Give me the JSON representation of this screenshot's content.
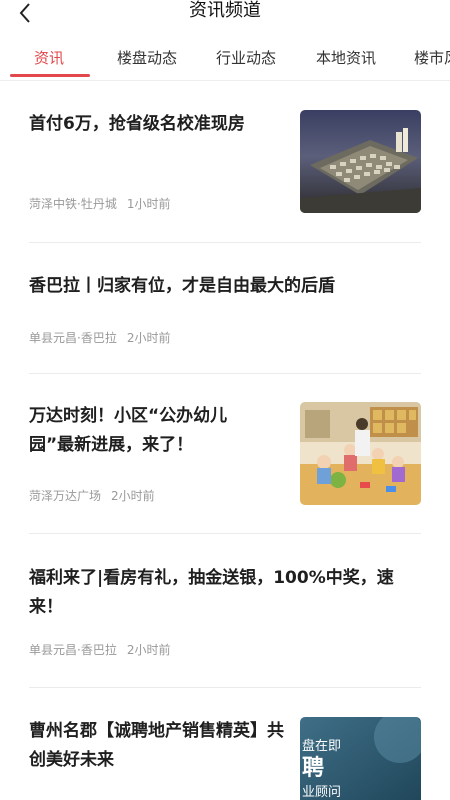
{
  "header": {
    "title": "资讯频道"
  },
  "tabs": [
    {
      "label": "资讯"
    },
    {
      "label": "楼盘动态"
    },
    {
      "label": "行业动态"
    },
    {
      "label": "本地资讯"
    },
    {
      "label": "楼市风"
    }
  ],
  "articles": [
    {
      "title": "首付6万，抢省级名校准现房",
      "source": "菏泽中铁·牡丹城",
      "time": "1小时前"
    },
    {
      "title": "香巴拉丨归家有位，才是自由最大的后盾",
      "source": "单县元昌·香巴拉",
      "time": "2小时前"
    },
    {
      "title": "万达时刻！小区“公办幼儿园”最新进展，来了！",
      "source": "菏泽万达广场",
      "time": "2小时前"
    },
    {
      "title": "福利来了|看房有礼，抽金送银，100%中奖，速来！",
      "source": "单县元昌·香巴拉",
      "time": "2小时前"
    },
    {
      "title": "曹州名郡【诚聘地产销售精英】共创美好未来",
      "source": "",
      "time": ""
    }
  ],
  "thumb_text": {
    "line1": "盘在即",
    "line2": "聘",
    "line3": "业顾问"
  },
  "colors": {
    "accent": "#e2474b"
  }
}
